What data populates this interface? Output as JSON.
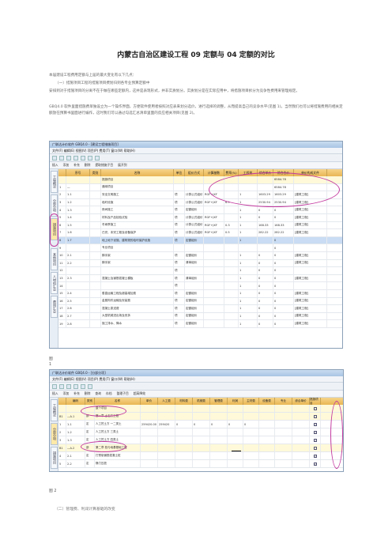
{
  "title": "内蒙古自治区建设工程 09 定额与 04 定额的对比",
  "paragraphs": {
    "p1": "本届建设工程费用定额与上届的最大变化有以下几点：",
    "p2": "（一）措施项目工程的措施项目费划归到各专业预算定额中",
    "p3": "安排到对于措施项目的分离不在于做在哪些定额内，这并是表现形式，并非实质划分。实质划分是在实际应用中，将措施项目拆分为竞争性费用来管理规定。",
    "p4": "GBQ4.0 软件里面措施费单独设立为一个操作界面，方便软件使用者按照对应表来划分选价，进行选择的调整，从而提高自己的竞争水平(见图 1)。当然我们也可以将措施费用的相关定额放在预算书里面进行编作，这时我们可以通过勾选汇总清单里面的反应相关项目(见图 2)。"
  },
  "shot1": {
    "window_title": "广联达计价软件 GBQ4.0 - [建设工程措施项目]",
    "menu": "文件(F)  编辑(E)  视图(V)  项目(P)  费用(T)  窗口(W)  帮助(H)",
    "toolbar2": [
      "插入",
      "添加",
      "补充",
      "删除",
      "提取措施子目",
      "展开到"
    ],
    "side_tabs": [
      "工程概况",
      "分部分项",
      "措施项目",
      "其他项目",
      "人材机汇总",
      "费用汇总"
    ],
    "columns": [
      "序号",
      "类别",
      "名称",
      "单位",
      "组价方式",
      "计算基数",
      "费率(%)",
      "工程量",
      "综合单价",
      "综合合价",
      "单价构成文件"
    ],
    "rows": [
      {
        "no": "",
        "code": "",
        "cat": "",
        "name": "措施项目",
        "unit": "",
        "base": "",
        "calc": "",
        "qty": "",
        "unitp": "",
        "rate": "",
        "total": "6584.78",
        "kind": "",
        "style": "group"
      },
      {
        "no": "1",
        "code": "—",
        "cat": "",
        "name": "通用项目",
        "unit": "",
        "base": "",
        "calc": "",
        "qty": "",
        "unitp": "",
        "rate": "",
        "total": "6584.78",
        "kind": "",
        "style": ""
      },
      {
        "no": "2",
        "code": "1.1",
        "cat": "",
        "name": "安全文明施工",
        "unit": "项",
        "base": "计算公式组价",
        "calc": "RGF+JXF",
        "qty": "",
        "unitp": "1",
        "rate": "1603.29",
        "total": "1603.29",
        "kind": "[建筑工程]",
        "style": ""
      },
      {
        "no": "3",
        "code": "1.2",
        "cat": "",
        "name": "临时设施",
        "unit": "项",
        "base": "计算公式组价",
        "calc": "RGF+JXF",
        "qty": "6.5",
        "unitp": "1",
        "rate": "2530.94",
        "total": "2530.94",
        "kind": "[建筑工程]",
        "style": ""
      },
      {
        "no": "4",
        "code": "1.3",
        "cat": "",
        "name": "夜间施工",
        "unit": "项",
        "base": "定额组价",
        "calc": "",
        "qty": "",
        "unitp": "1",
        "rate": "0",
        "total": "0",
        "kind": "[建筑工程]",
        "style": ""
      },
      {
        "no": "5",
        "code": "1.4",
        "cat": "",
        "name": "材料及产品检验试验",
        "unit": "项",
        "base": "计算公式组价",
        "calc": "RGF+JXF",
        "qty": "",
        "unitp": "1",
        "rate": "0",
        "total": "0",
        "kind": "[建筑工程]",
        "style": ""
      },
      {
        "no": "6",
        "code": "1.5",
        "cat": "",
        "name": "冬雨季施工",
        "unit": "项",
        "base": "计算公式组价",
        "calc": "RGF+JXF",
        "qty": "0.3",
        "unitp": "1",
        "rate": "168.33",
        "total": "168.33",
        "kind": "[建筑工程]",
        "style": ""
      },
      {
        "no": "7",
        "code": "1.6",
        "cat": "",
        "name": "已完、未完工程及设备保护",
        "unit": "项",
        "base": "计算公式组价",
        "calc": "RGF+JXF",
        "qty": "0.5",
        "unitp": "1",
        "rate": "282.22",
        "total": "282.22",
        "kind": "[建筑工程]",
        "style": ""
      },
      {
        "no": "8",
        "code": "1.7",
        "cat": "",
        "name": "地上地下设施、建筑物的临时保护设施",
        "unit": "项",
        "base": "定额组价",
        "calc": "",
        "qty": "",
        "unitp": "1",
        "rate": "",
        "total": "0",
        "kind": "",
        "style": "selected"
      },
      {
        "no": "9",
        "code": "",
        "cat": "",
        "name": "专业项目",
        "unit": "",
        "base": "",
        "calc": "",
        "qty": "",
        "unitp": "",
        "rate": "",
        "total": "0",
        "kind": "",
        "style": ""
      },
      {
        "no": "10",
        "code": "2.1",
        "cat": "",
        "name": "脚手架",
        "unit": "项",
        "base": "定额组价",
        "calc": "",
        "qty": "",
        "unitp": "1",
        "rate": "0",
        "total": "0",
        "kind": "[建筑工程]",
        "style": ""
      },
      {
        "no": "11",
        "code": "2.2",
        "cat": "",
        "name": "脚手架",
        "unit": "项",
        "base": "清单组价",
        "calc": "",
        "qty": "",
        "unitp": "1",
        "rate": "0",
        "total": "0",
        "kind": "[建筑工程]",
        "style": ""
      },
      {
        "no": "12",
        "code": "",
        "cat": "",
        "name": "",
        "unit": "项",
        "base": "",
        "calc": "",
        "qty": "",
        "unitp": "1",
        "rate": "0",
        "total": "0",
        "kind": "",
        "style": ""
      },
      {
        "no": "13",
        "code": "2.3",
        "cat": "",
        "name": "混凝土及钢筋混凝土模板",
        "unit": "项",
        "base": "清单组价",
        "calc": "",
        "qty": "",
        "unitp": "1",
        "rate": "0",
        "total": "0",
        "kind": "[建筑工程]",
        "style": ""
      },
      {
        "no": "14",
        "code": "",
        "cat": "",
        "name": "",
        "unit": "项",
        "base": "",
        "calc": "",
        "qty": "",
        "unitp": "1",
        "rate": "0",
        "total": "0",
        "kind": "",
        "style": ""
      },
      {
        "no": "15",
        "code": "2.4",
        "cat": "",
        "name": "垂直运输工程及超高增加费",
        "unit": "项",
        "base": "定额组价",
        "calc": "",
        "qty": "",
        "unitp": "1",
        "rate": "0",
        "total": "0",
        "kind": "[建筑工程]",
        "style": ""
      },
      {
        "no": "16",
        "code": "2.5",
        "cat": "",
        "name": "金属构件运输及安装费",
        "unit": "项",
        "base": "定额组价",
        "calc": "",
        "qty": "",
        "unitp": "1",
        "rate": "0",
        "total": "0",
        "kind": "[建筑工程]",
        "style": ""
      },
      {
        "no": "17",
        "code": "2.6",
        "cat": "",
        "name": "混凝土泵送费",
        "unit": "项",
        "base": "定额组价",
        "calc": "",
        "qty": "",
        "unitp": "1",
        "rate": "0",
        "total": "0",
        "kind": "[建筑工程]",
        "style": ""
      },
      {
        "no": "18",
        "code": "2.7",
        "cat": "",
        "name": "大型机械进出场及安拆",
        "unit": "项",
        "base": "定额组价",
        "calc": "",
        "qty": "",
        "unitp": "1",
        "rate": "0",
        "total": "0",
        "kind": "[建筑工程]",
        "style": ""
      },
      {
        "no": "19",
        "code": "2.8",
        "cat": "",
        "name": "施工排水、降水",
        "unit": "项",
        "base": "定额组价",
        "calc": "",
        "qty": "",
        "unitp": "1",
        "rate": "0",
        "total": "0",
        "kind": "[建筑工程]",
        "style": ""
      }
    ]
  },
  "captions": {
    "fig1a": "图",
    "fig1b": "1",
    "fig2": "图 2"
  },
  "shot2": {
    "window_title": "广联达计价软件 GBQ4.0 - [分部分项]",
    "menu": "文件(F)  编辑(E)  视图(V)  项目(P)  费用(T)  窗口(W)  帮助(H)",
    "toolbar2": [
      "插入",
      "添加",
      "补充",
      "删除",
      "查询",
      "存档",
      "整理子目",
      "超高降效"
    ],
    "columns": [
      "编码",
      "类别",
      "名称",
      "单价",
      "人工费",
      "材料费",
      "机械费",
      "管理费",
      "利润",
      "主材费",
      "设备费",
      "专业",
      "综合单价",
      "措施项目"
    ],
    "rows": [
      {
        "no": "",
        "code": "",
        "cat": "",
        "name": "整个项目",
        "v1": "",
        "v2": "",
        "v3": "",
        "v4": "",
        "v5": "",
        "v6": "",
        "v7": "",
        "v8": "",
        "v9": "",
        "v10": "",
        "chk": false,
        "style": "group"
      },
      {
        "no": "B1",
        "code": "—A.1",
        "cat": "部",
        "name": "第一章 土石方工程",
        "v1": "",
        "v2": "",
        "v3": "",
        "v4": "",
        "v5": "",
        "v6": "",
        "v7": "",
        "v8": "",
        "v9": "",
        "v10": "",
        "chk": false,
        "style": "group"
      },
      {
        "no": "1",
        "code": "1-1",
        "cat": "定",
        "name": "人工挖土方 一二类土",
        "v1": "259420.00",
        "v2": "259420",
        "v3": "0",
        "v4": "0",
        "v5": "0",
        "v6": "0",
        "v7": "0",
        "v8": "",
        "v9": "",
        "v10": "",
        "chk": true,
        "style": ""
      },
      {
        "no": "2",
        "code": "1-2",
        "cat": "定",
        "name": "人工挖土方 三类土",
        "v1": "",
        "v2": "",
        "v3": "",
        "v4": "",
        "v5": "",
        "v6": "",
        "v7": "",
        "v8": "",
        "v9": "",
        "v10": "",
        "chk": true,
        "style": ""
      },
      {
        "no": "3",
        "code": "1-3",
        "cat": "定",
        "name": "人工挖土方 四类土",
        "v1": "",
        "v2": "",
        "v3": "",
        "v4": "",
        "v5": "",
        "v6": "",
        "v7": "",
        "v8": "",
        "v9": "",
        "v10": "",
        "chk": true,
        "style": ""
      },
      {
        "no": "B1",
        "code": "—A.2",
        "cat": "部",
        "name": "第二章 桩与地基基础工程",
        "v1": "",
        "v2": "",
        "v3": "",
        "v4": "",
        "v5": "",
        "v6": "",
        "v7": "",
        "v8": "",
        "v9": "",
        "v10": "",
        "chk": false,
        "style": "group"
      },
      {
        "no": "4",
        "code": "2-1",
        "cat": "定",
        "name": "打预制钢筋混凝土桩",
        "v1": "",
        "v2": "",
        "v3": "",
        "v4": "",
        "v5": "",
        "v6": "",
        "v7": "",
        "v8": "",
        "v9": "",
        "v10": "",
        "chk": true,
        "style": ""
      },
      {
        "no": "5",
        "code": "2-2",
        "cat": "定",
        "name": "静力压桩",
        "v1": "",
        "v2": "",
        "v3": "",
        "v4": "",
        "v5": "",
        "v6": "",
        "v7": "",
        "v8": "",
        "v9": "",
        "v10": "",
        "chk": true,
        "style": ""
      }
    ]
  },
  "closing": "（二）管理费、利润计算基础的改变"
}
